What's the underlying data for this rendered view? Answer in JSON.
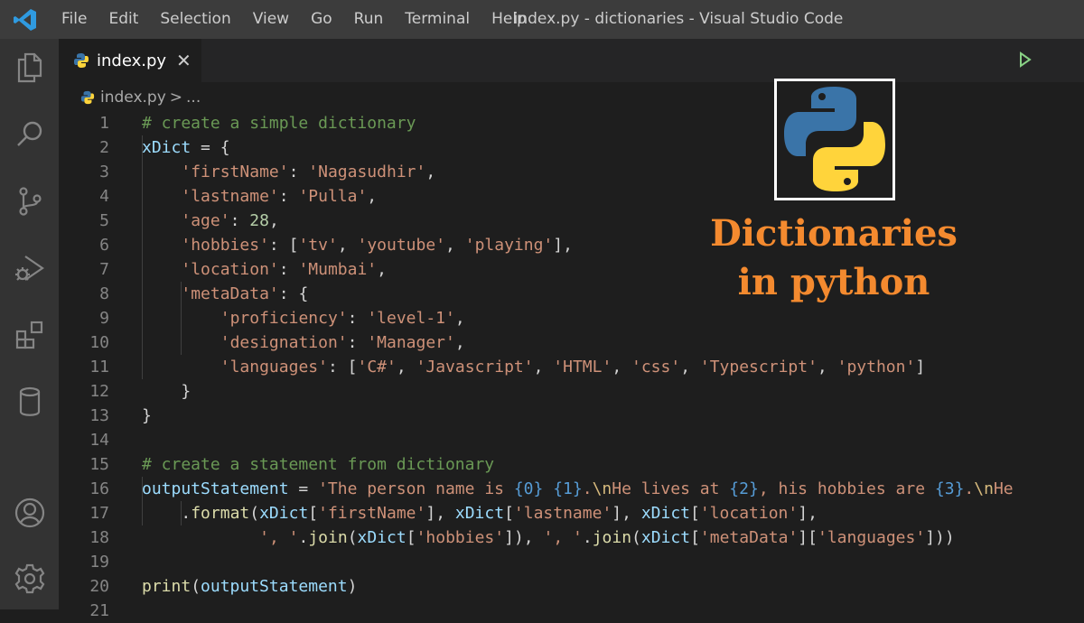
{
  "titlebar": {
    "menu": [
      "File",
      "Edit",
      "Selection",
      "View",
      "Go",
      "Run",
      "Terminal",
      "Help"
    ],
    "window_title": "index.py - dictionaries - Visual Studio Code"
  },
  "activitybar": {
    "icons": [
      "files-icon",
      "search-icon",
      "source-control-icon",
      "run-debug-icon",
      "extensions-icon",
      "database-icon",
      "account-icon",
      "settings-gear-icon"
    ]
  },
  "tab": {
    "label": "index.py",
    "close": "✕"
  },
  "breadcrumb": {
    "file": "index.py",
    "separator": ">",
    "more": "..."
  },
  "code": {
    "line_numbers": [
      "1",
      "2",
      "3",
      "4",
      "5",
      "6",
      "7",
      "8",
      "9",
      "10",
      "11",
      "12",
      "13",
      "14",
      "15",
      "16",
      "17",
      "18",
      "19",
      "20",
      "21"
    ],
    "lines": [
      "# create a simple dictionary",
      "xDict = {",
      "    'firstName': 'Nagasudhir',",
      "    'lastname': 'Pulla',",
      "    'age': 28,",
      "    'hobbies': ['tv', 'youtube', 'playing'],",
      "    'location': 'Mumbai',",
      "    'metaData': {",
      "        'proficiency': 'level-1',",
      "        'designation': 'Manager',",
      "        'languages': ['C#', 'Javascript', 'HTML', 'css', 'Typescript', 'python']",
      "    }",
      "}",
      "",
      "# create a statement from dictionary",
      "outputStatement = 'The person name is {0} {1}.\\nHe lives at {2}, his hobbies are {3}.\\nHe",
      "    .format(xDict['firstName'], xDict['lastname'], xDict['location'],",
      "            ', '.join(xDict['hobbies']), ', '.join(xDict['metaData']['languages']))",
      "",
      "print(outputStatement)",
      ""
    ]
  },
  "overlay": {
    "title_line1": "Dictionaries",
    "title_line2": "in python"
  },
  "colors": {
    "accent_orange": "#f48a2f",
    "python_blue": "#3a74a8",
    "python_yellow": "#ffd43b",
    "run_green": "#89d185"
  }
}
